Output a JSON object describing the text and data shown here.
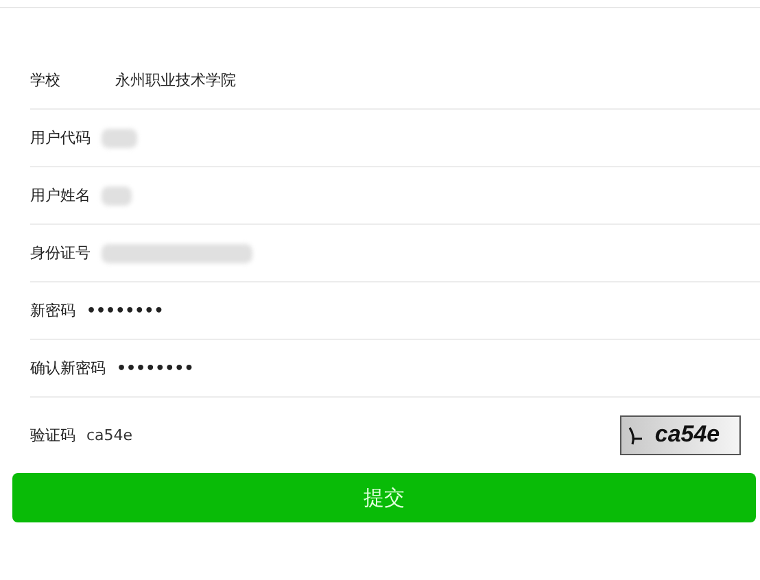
{
  "form": {
    "rows": [
      {
        "label": "学校",
        "kind": "text",
        "value": "永州职业技术学院"
      },
      {
        "label": "用户代码",
        "kind": "redacted"
      },
      {
        "label": "用户姓名",
        "kind": "redacted"
      },
      {
        "label": "身份证号",
        "kind": "redacted"
      },
      {
        "label": "新密码",
        "kind": "password",
        "value": "••••••••"
      },
      {
        "label": "确认新密码",
        "kind": "password",
        "value": "••••••••"
      },
      {
        "label": "验证码",
        "kind": "captcha",
        "value": "ca54e",
        "captcha_text": "ca54e"
      }
    ]
  },
  "submit_button": "提交"
}
